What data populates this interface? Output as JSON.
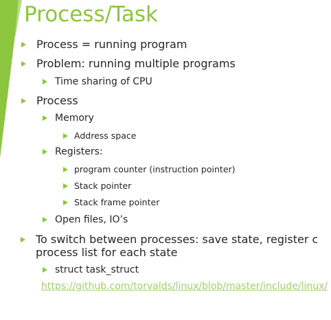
{
  "slide": {
    "title": "Process/Task",
    "accent_color": "#8cc63e",
    "bullets": {
      "b1": "Process = running program",
      "b2": "Problem: running multiple programs",
      "b2_1": "Time sharing of CPU",
      "b3": "Process",
      "b3_1": "Memory",
      "b3_1_1": "Address space",
      "b3_2": "Registers:",
      "b3_2_1": "program counter (instruction pointer)",
      "b3_2_2": "Stack pointer",
      "b3_2_3": "Stack frame pointer",
      "b3_3": "Open files, IO’s",
      "b4_line1": "To switch between processes: save state, register c",
      "b4_line2": "process list for each state",
      "b4_1": "struct task_struct"
    },
    "link": "https://github.com/torvalds/linux/blob/master/include/linux/"
  }
}
